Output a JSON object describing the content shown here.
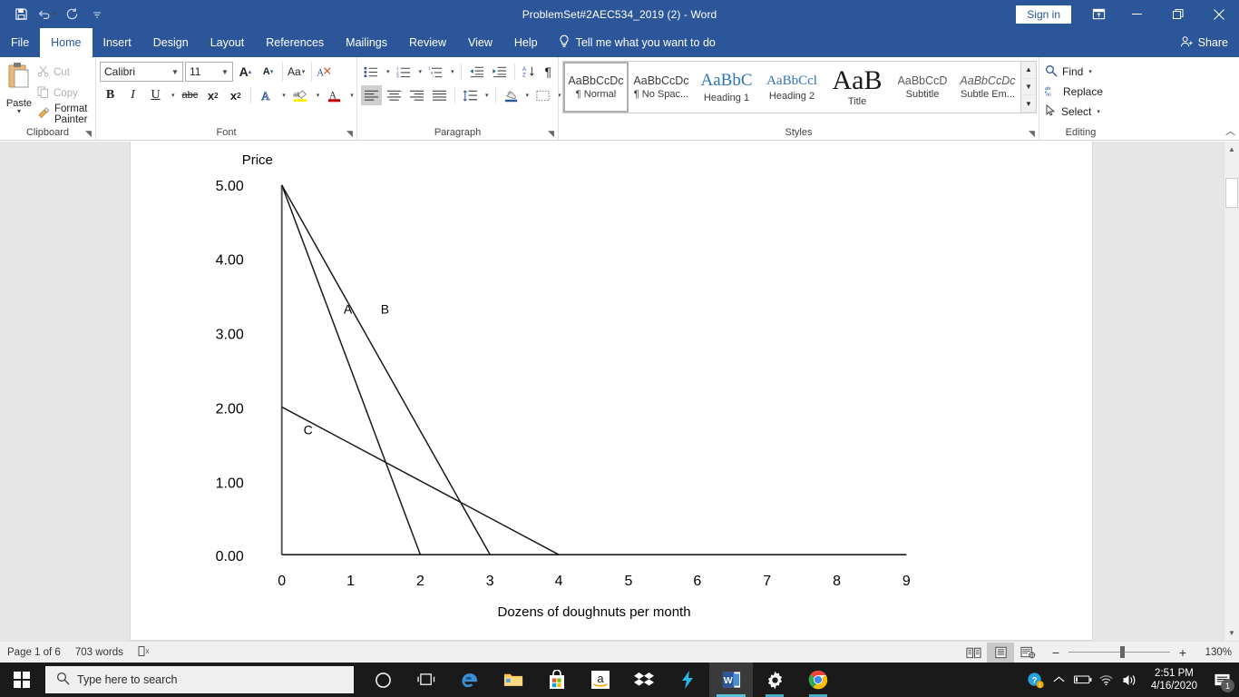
{
  "titlebar": {
    "document_title": "ProblemSet#2AEC534_2019 (2)  -  Word",
    "signin_label": "Sign in",
    "qat": [
      {
        "name": "save-icon",
        "label": "Save"
      },
      {
        "name": "undo-icon",
        "label": "Undo"
      },
      {
        "name": "redo-icon",
        "label": "Redo"
      },
      {
        "name": "customize-qat-icon",
        "label": "Customize Quick Access Toolbar"
      }
    ],
    "window_controls": {
      "ribbon_display": "Ribbon Display Options",
      "minimize": "Minimize",
      "restore": "Restore Down",
      "close": "Close"
    }
  },
  "tabs": [
    {
      "label": "File",
      "active": false
    },
    {
      "label": "Home",
      "active": true
    },
    {
      "label": "Insert",
      "active": false
    },
    {
      "label": "Design",
      "active": false
    },
    {
      "label": "Layout",
      "active": false
    },
    {
      "label": "References",
      "active": false
    },
    {
      "label": "Mailings",
      "active": false
    },
    {
      "label": "Review",
      "active": false
    },
    {
      "label": "View",
      "active": false
    },
    {
      "label": "Help",
      "active": false
    }
  ],
  "tellme": {
    "placeholder": "Tell me what you want to do",
    "icon": "lightbulb-icon"
  },
  "share": {
    "label": "Share",
    "icon": "share-person-icon"
  },
  "ribbon": {
    "clipboard": {
      "group_label": "Clipboard",
      "paste_label": "Paste",
      "items": [
        {
          "label": "Cut",
          "icon": "scissors-icon",
          "enabled": false
        },
        {
          "label": "Copy",
          "icon": "copy-icon",
          "enabled": false
        },
        {
          "label": "Format Painter",
          "icon": "paintbrush-icon",
          "enabled": true
        }
      ]
    },
    "font": {
      "group_label": "Font",
      "font_name": "Calibri",
      "font_size": "11",
      "buttons": [
        {
          "name": "grow-font-icon",
          "glyph": "A"
        },
        {
          "name": "shrink-font-icon",
          "glyph": "A"
        },
        {
          "name": "change-case-icon",
          "glyph": "Aa"
        },
        {
          "name": "clear-formatting-icon",
          "glyph": "A"
        },
        {
          "name": "bold-icon",
          "glyph": "B"
        },
        {
          "name": "italic-icon",
          "glyph": "I"
        },
        {
          "name": "underline-icon",
          "glyph": "U"
        },
        {
          "name": "strikethrough-icon",
          "glyph": "abc"
        },
        {
          "name": "subscript-icon",
          "glyph": "x"
        },
        {
          "name": "superscript-icon",
          "glyph": "x"
        },
        {
          "name": "text-effects-icon",
          "glyph": "A"
        },
        {
          "name": "text-highlight-icon",
          "glyph": "ab"
        },
        {
          "name": "font-color-icon",
          "glyph": "A"
        }
      ]
    },
    "paragraph": {
      "group_label": "Paragraph",
      "buttons": [
        {
          "name": "bullets-icon"
        },
        {
          "name": "numbering-icon"
        },
        {
          "name": "multilevel-list-icon"
        },
        {
          "name": "decrease-indent-icon"
        },
        {
          "name": "increase-indent-icon"
        },
        {
          "name": "sort-icon"
        },
        {
          "name": "show-formatting-marks-icon"
        },
        {
          "name": "align-left-icon"
        },
        {
          "name": "align-center-icon"
        },
        {
          "name": "align-right-icon"
        },
        {
          "name": "justify-icon"
        },
        {
          "name": "line-spacing-icon"
        },
        {
          "name": "shading-icon"
        },
        {
          "name": "borders-icon"
        }
      ]
    },
    "styles": {
      "group_label": "Styles",
      "items": [
        {
          "preview": "AaBbCcDc",
          "name": "¶ Normal",
          "selected": true
        },
        {
          "preview": "AaBbCcDc",
          "name": "¶ No Spac...",
          "selected": false
        },
        {
          "preview": "AaBbC",
          "name": "Heading 1",
          "selected": false
        },
        {
          "preview": "AaBbCcl",
          "name": "Heading 2",
          "selected": false
        },
        {
          "preview": "AaB",
          "name": "Title",
          "selected": false
        },
        {
          "preview": "AaBbCcD",
          "name": "Subtitle",
          "selected": false
        },
        {
          "preview": "AaBbCcDc",
          "name": "Subtle Em...",
          "selected": false
        }
      ]
    },
    "editing": {
      "group_label": "Editing",
      "items": [
        {
          "label": "Find",
          "icon": "search-icon",
          "caret": true
        },
        {
          "label": "Replace",
          "icon": "replace-icon",
          "caret": false
        },
        {
          "label": "Select",
          "icon": "cursor-arrow-icon",
          "caret": true
        }
      ]
    },
    "collapse_label": "Collapse the Ribbon"
  },
  "chart_data": {
    "type": "line",
    "title": "",
    "ylabel": "Price",
    "xlabel": "Dozens of doughnuts per month",
    "xlim": [
      0,
      9
    ],
    "ylim": [
      0,
      5
    ],
    "xticks": [
      "0",
      "1",
      "2",
      "3",
      "4",
      "5",
      "6",
      "7",
      "8",
      "9"
    ],
    "yticks": [
      "0.00",
      "1.00",
      "2.00",
      "3.00",
      "4.00",
      "5.00"
    ],
    "grid": false,
    "legend": "inline-labels",
    "series": [
      {
        "name": "A",
        "label_pos": {
          "x": 0.95,
          "y": 3.35
        },
        "points": [
          {
            "x": 0,
            "y": 5.0
          },
          {
            "x": 2,
            "y": 0.0
          }
        ]
      },
      {
        "name": "B",
        "label_pos": {
          "x": 1.48,
          "y": 3.35
        },
        "points": [
          {
            "x": 0,
            "y": 5.0
          },
          {
            "x": 3,
            "y": 0.0
          }
        ]
      },
      {
        "name": "C",
        "label_pos": {
          "x": 0.33,
          "y": 1.72
        },
        "points": [
          {
            "x": 0,
            "y": 2.0
          },
          {
            "x": 4,
            "y": 0.0
          }
        ]
      }
    ]
  },
  "statusbar": {
    "page_label": "Page 1 of 6",
    "word_count": "703 words",
    "proofing_icon": "proofing-errors-icon",
    "views": [
      {
        "name": "read-mode-icon",
        "active": false
      },
      {
        "name": "print-layout-icon",
        "active": true
      },
      {
        "name": "web-layout-icon",
        "active": false
      }
    ],
    "zoom_out": "−",
    "zoom_in": "+",
    "zoom_level": "130%"
  },
  "taskbar": {
    "start": "start-icon",
    "search_placeholder": "Type here to search",
    "apps": [
      {
        "name": "cortana-icon",
        "label": "Cortana",
        "state": "normal"
      },
      {
        "name": "task-view-icon",
        "label": "Task View",
        "state": "normal"
      },
      {
        "name": "edge-icon",
        "label": "Microsoft Edge",
        "state": "normal"
      },
      {
        "name": "file-explorer-icon",
        "label": "File Explorer",
        "state": "normal"
      },
      {
        "name": "microsoft-store-icon",
        "label": "Microsoft Store",
        "state": "normal"
      },
      {
        "name": "amazon-icon",
        "label": "Amazon",
        "state": "normal"
      },
      {
        "name": "dropbox-icon",
        "label": "Dropbox",
        "state": "normal"
      },
      {
        "name": "lightning-app-icon",
        "label": "App",
        "state": "normal"
      },
      {
        "name": "word-icon",
        "label": "Word",
        "state": "active"
      },
      {
        "name": "settings-gear-icon",
        "label": "Settings",
        "state": "open"
      },
      {
        "name": "chrome-icon",
        "label": "Google Chrome",
        "state": "open"
      }
    ],
    "tray": [
      {
        "name": "help-warning-icon"
      },
      {
        "name": "show-hidden-icons-icon"
      },
      {
        "name": "battery-icon"
      },
      {
        "name": "wifi-icon"
      },
      {
        "name": "volume-icon"
      }
    ],
    "clock_time": "2:51 PM",
    "clock_date": "4/16/2020",
    "notification_count": "1"
  },
  "colors": {
    "word_blue": "#2b579a",
    "accent_white": "#ffffff",
    "chart_line": "#1a1a1a",
    "taskbar": "#1a1a1a"
  }
}
